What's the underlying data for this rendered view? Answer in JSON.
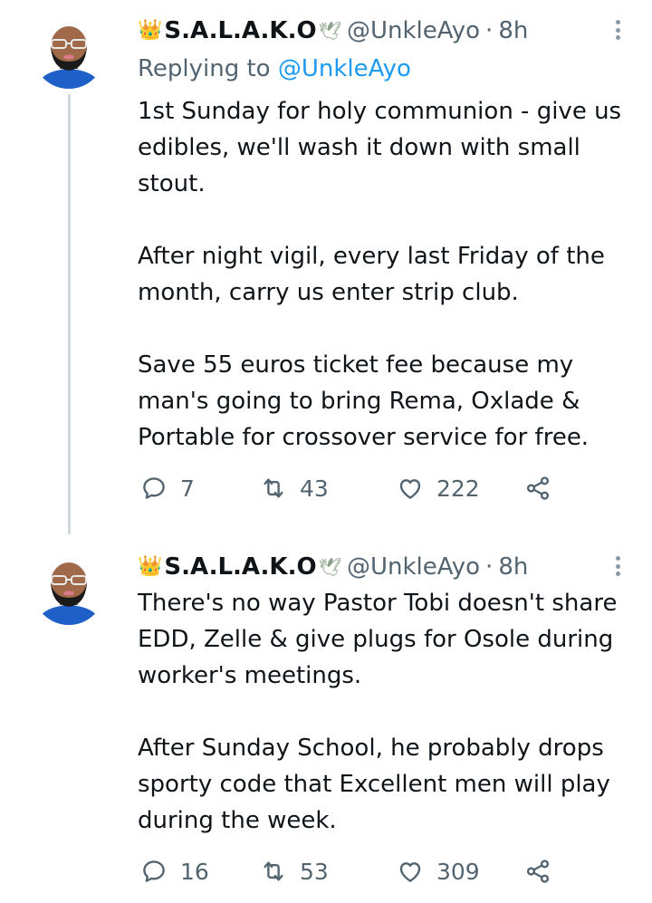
{
  "tweets": [
    {
      "user": {
        "crown": "👑",
        "display_name": "S.A.L.A.K.O",
        "dove": "🕊",
        "handle": "@UnkleAyo",
        "separator": "·",
        "time": "8h"
      },
      "replying_label": "Replying to",
      "replying_handle": "@UnkleAyo",
      "paragraphs": [
        "1st Sunday for holy communion - give us edibles, we'll wash it down with small stout.",
        "After night vigil, every last Friday of the month, carry us enter strip club.",
        "Save 55 euros ticket fee because my man's going to bring Rema, Oxlade & Portable for crossover service for free."
      ],
      "stats": {
        "replies": "7",
        "retweets": "43",
        "likes": "222"
      }
    },
    {
      "user": {
        "crown": "👑",
        "display_name": "S.A.L.A.K.O",
        "dove": "🕊",
        "handle": "@UnkleAyo",
        "separator": "·",
        "time": "8h"
      },
      "paragraphs": [
        "There's no way Pastor Tobi doesn't share EDD, Zelle & give plugs for Osole during worker's meetings.",
        "After Sunday School, he probably drops sporty code that Excellent men will play during the week."
      ],
      "stats": {
        "replies": "16",
        "retweets": "53",
        "likes": "309"
      }
    }
  ],
  "colors": {
    "text": "#0f1419",
    "secondary": "#536471",
    "link": "#1d9bf0",
    "thread_line": "#cfd9de"
  },
  "icons": [
    "reply-icon",
    "retweet-icon",
    "like-icon",
    "share-icon",
    "more-icon",
    "avatar"
  ]
}
